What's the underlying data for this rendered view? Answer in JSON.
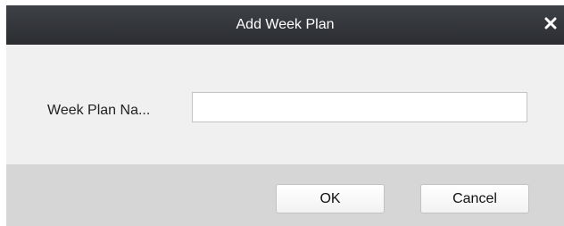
{
  "dialog": {
    "title": "Add Week Plan",
    "close_icon": "close-icon",
    "colors": {
      "titlebar": "#2f3236",
      "content_bg": "#f0f0f0",
      "footer_bg": "#d6d6d6"
    }
  },
  "form": {
    "name_label": "Week Plan Na...",
    "name_value": "",
    "name_placeholder": ""
  },
  "buttons": {
    "ok_label": "OK",
    "cancel_label": "Cancel"
  }
}
